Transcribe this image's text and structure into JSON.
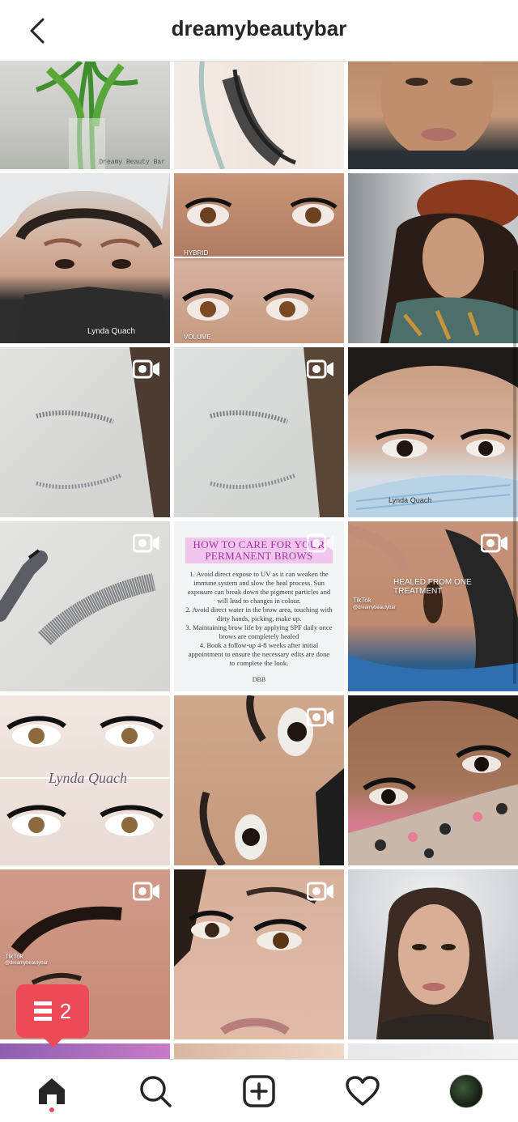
{
  "header": {
    "title": "dreamybeautybar"
  },
  "posts": [
    {
      "caption": "Dreamy Beauty Bar"
    },
    {
      "caption": ""
    },
    {
      "caption": ""
    },
    {
      "caption": "Lynda Quach"
    },
    {
      "caption_top": "HYBRID",
      "caption_bottom": "VOLUME"
    },
    {
      "caption": ""
    },
    {
      "caption": ""
    },
    {
      "caption": ""
    },
    {
      "caption": "Lynda Quach"
    },
    {
      "caption": ""
    },
    {
      "title": "HOW TO CARE FOR YOUR PERMANENT BROWS",
      "lines": [
        "1. Avoid direct expose to UV as it can weaken the immune system and slow the heal process. Sun exposure can break down the pigment particles and will lead to changes in colour.",
        "2. Avoid direct water in the brow area, touching with dirty hands, picking, make up.",
        "3. Maintaining brow life by applying SPF daily once brows are completely healed",
        "4. Book a follow-up 4-8 weeks after initial appointment to ensure the necessary edits are done to complete the look."
      ],
      "signature": "DBB"
    },
    {
      "caption": "HEALED FROM ONE TREATMENT",
      "tiktok": "TikTok",
      "handle": "@dreamybeautybar"
    },
    {
      "caption": "Lynda Quach"
    },
    {
      "caption": ""
    },
    {
      "caption": ""
    },
    {
      "tiktok": "TikTok",
      "handle": "@dreamybeautybar"
    },
    {
      "caption": ""
    },
    {
      "caption": ""
    }
  ],
  "notification": {
    "count": "2",
    "icon": "activity-list-icon"
  },
  "nav": {
    "items": [
      "home-icon",
      "search-icon",
      "new-post-icon",
      "heart-icon",
      "profile-avatar"
    ],
    "active": "home-icon"
  },
  "colors": {
    "accent": "#ed4956",
    "text": "#262626",
    "divider": "#dbdbdb"
  }
}
